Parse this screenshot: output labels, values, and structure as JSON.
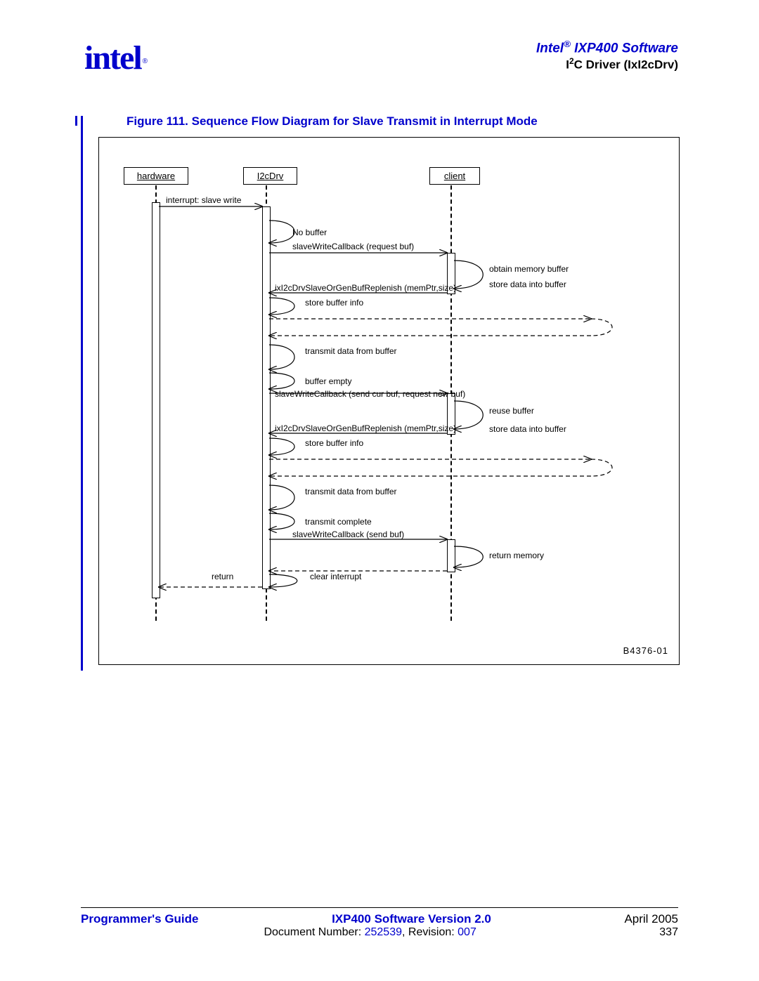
{
  "header": {
    "title_prefix": "Intel",
    "title_reg": "®",
    "title_suffix": " IXP400 Software",
    "subtitle_prefix": "I",
    "subtitle_sup": "2",
    "subtitle_suffix": "C Driver (IxI2cDrv)"
  },
  "logo": {
    "text": "intel",
    "reg": "®"
  },
  "figure": {
    "title": "Figure 111. Sequence Flow Diagram for Slave Transmit in Interrupt Mode"
  },
  "diagram": {
    "participants": {
      "hardware": "hardware",
      "i2cdrv": "I2cDrv",
      "client": "client"
    },
    "labels": {
      "interrupt_slave_write": "interrupt: slave write",
      "no_buffer": "No buffer",
      "callback_request": "slaveWriteCallback (request buf)",
      "obtain_memory": "obtain memory buffer",
      "store_data1": "store data into buffer",
      "replenish1": "ixI2cDrvSlaveOrGenBufReplenish (memPtr,size)",
      "store_buffer_info1": "store buffer info",
      "transmit1": "transmit data from buffer",
      "buffer_empty": "buffer empty",
      "callback_send_cur": "slaveWriteCallback (send cur buf, request new buf)",
      "reuse_buffer": "reuse buffer",
      "store_data2": "store data into buffer",
      "replenish2": "ixI2cDrvSlaveOrGenBufReplenish (memPtr,size)",
      "store_buffer_info2": "store buffer info",
      "transmit2": "transmit data from buffer",
      "transmit_complete": "transmit complete",
      "callback_send_buf": "slaveWriteCallback (send buf)",
      "return_memory": "return memory",
      "return": "return",
      "clear_interrupt": "clear interrupt"
    },
    "id": "B4376-01"
  },
  "footer": {
    "guide": "Programmer's Guide",
    "version": "IXP400 Software Version 2.0",
    "date": "April 2005",
    "doc_label": "Document Number: ",
    "doc_num": "252539",
    "rev_label": ", Revision: ",
    "rev_num": "007",
    "page": "337"
  }
}
